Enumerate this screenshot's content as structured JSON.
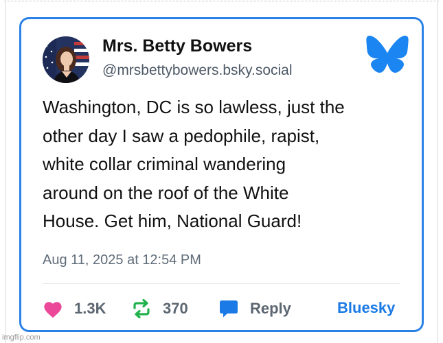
{
  "author": {
    "display_name": "Mrs. Betty Bowers",
    "handle": "@mrsbettybowers.bsky.social"
  },
  "post": {
    "lines": [
      "Washington, DC is so lawless, just the",
      "other day I saw a pedophile, rapist,",
      "white collar criminal wandering",
      "around on the roof of the White",
      "House. Get him, National Guard!"
    ],
    "timestamp": "Aug 11, 2025 at 12:54 PM"
  },
  "actions": {
    "likes": "1.3K",
    "reposts": "370",
    "reply_label": "Reply"
  },
  "source_link": "Bluesky",
  "watermark": "imgflip.com",
  "colors": {
    "card_border": "#2a81e6",
    "bluesky_blue": "#1b7ae6",
    "like_pink": "#ec4899",
    "repost_green": "#21b24b",
    "reply_blue": "#1b7ae6"
  },
  "icons": {
    "logo": "bluesky-butterfly-icon",
    "like": "heart-icon",
    "repost": "repost-arrows-icon",
    "reply": "speech-bubble-icon"
  }
}
